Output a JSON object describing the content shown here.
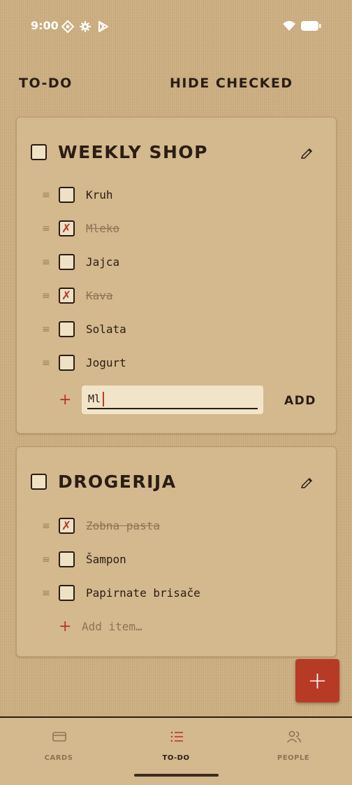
{
  "status_bar": {
    "time": "9:00"
  },
  "top_bar": {
    "title": "TO-DO",
    "action": "HIDE CHECKED"
  },
  "lists": [
    {
      "title": "WEEKLY SHOP",
      "checked": false,
      "items": [
        {
          "label": "Kruh",
          "checked": false
        },
        {
          "label": "Mleko",
          "checked": true
        },
        {
          "label": "Jajca",
          "checked": false
        },
        {
          "label": "Kava",
          "checked": true
        },
        {
          "label": "Solata",
          "checked": false
        },
        {
          "label": "Jogurt",
          "checked": false
        }
      ],
      "add_input_value": "Ml",
      "add_button": "ADD"
    },
    {
      "title": "DROGERIJA",
      "checked": false,
      "items": [
        {
          "label": "Zobna pasta",
          "checked": true
        },
        {
          "label": "Šampon",
          "checked": false
        },
        {
          "label": "Papirnate brisače",
          "checked": false
        }
      ],
      "add_placeholder": "Add item…"
    }
  ],
  "bottom_nav": {
    "items": [
      {
        "label": "CARDS",
        "icon": "card-icon",
        "active": false
      },
      {
        "label": "TO-DO",
        "icon": "list-icon",
        "active": true
      },
      {
        "label": "PEOPLE",
        "icon": "people-icon",
        "active": false
      }
    ]
  },
  "colors": {
    "background": "#cdb083",
    "card": "#d4b88e",
    "accent": "#b73a26",
    "text": "#2a1d12",
    "muted": "#8d7455"
  }
}
